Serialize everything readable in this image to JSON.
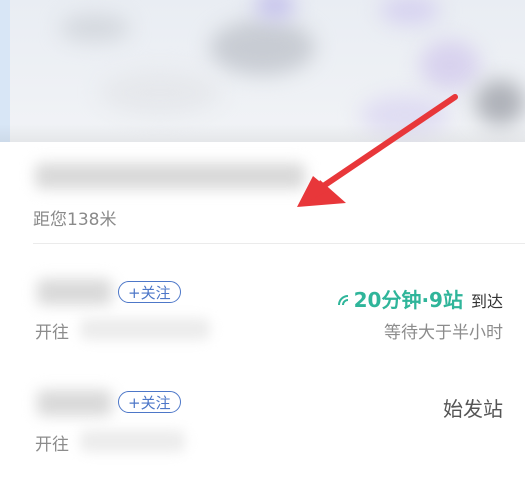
{
  "stop": {
    "distance_text": "距您138米"
  },
  "routes": [
    {
      "follow_label": "+关注",
      "to_prefix": "开往",
      "arrival": {
        "eta": "20分钟·9站",
        "suffix": "到达",
        "note": "等待大于半小时"
      }
    },
    {
      "follow_label": "+关注",
      "to_prefix": "开往",
      "status": "始发站"
    }
  ],
  "colors": {
    "accent_green": "#2fb59a",
    "accent_blue": "#4d77c8",
    "arrow_red": "#e8373a"
  },
  "icons": [
    "signal-icon",
    "arrow-annotation"
  ]
}
